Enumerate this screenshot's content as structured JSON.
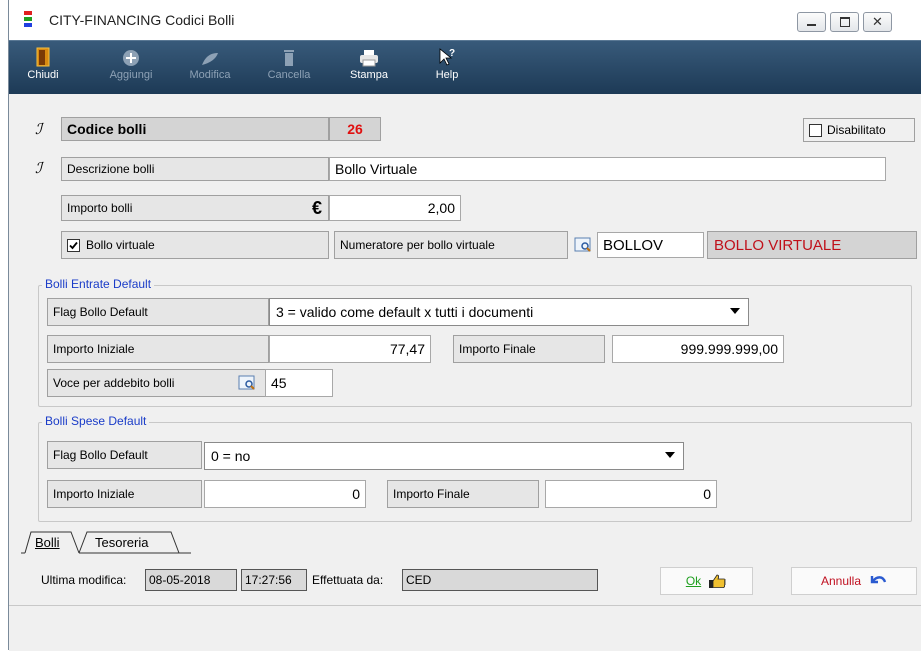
{
  "window": {
    "title": "CITY-FINANCING  Codici Bolli",
    "controls": {
      "minimize_icon": "minimize-icon",
      "maximize_icon": "maximize-icon",
      "close_icon": "close-icon"
    }
  },
  "toolbar": {
    "items": [
      {
        "label": "Chiudi",
        "icon": "exit-door-icon",
        "enabled": true
      },
      {
        "label": "Aggiungi",
        "icon": "add-icon",
        "enabled": false
      },
      {
        "label": "Modifica",
        "icon": "edit-icon",
        "enabled": false
      },
      {
        "label": "Cancella",
        "icon": "trash-icon",
        "enabled": false
      },
      {
        "label": "Stampa",
        "icon": "printer-icon",
        "enabled": true
      },
      {
        "label": "Help",
        "icon": "help-cursor-icon",
        "enabled": true
      }
    ]
  },
  "form": {
    "codice_label": "Codice bolli",
    "codice_value": "26",
    "disabilitato_label": "Disabilitato",
    "disabilitato_checked": false,
    "descrizione_label": "Descrizione bolli",
    "descrizione_value": "Bollo Virtuale",
    "importo_label": "Importo bolli",
    "currency_symbol": "€",
    "importo_value": "2,00",
    "bollo_virtuale_label": "Bollo virtuale",
    "bollo_virtuale_checked": true,
    "numeratore_label": "Numeratore per bollo virtuale",
    "numeratore_code": "BOLLOV",
    "numeratore_desc": "BOLLO VIRTUALE"
  },
  "entrate": {
    "title": "Bolli Entrate Default",
    "flag_label": "Flag Bollo Default",
    "flag_value": "3 = valido come default x tutti i documenti",
    "importo_iniziale_label": "Importo Iniziale",
    "importo_iniziale_value": "77,47",
    "importo_finale_label": "Importo Finale",
    "importo_finale_value": "999.999.999,00",
    "voce_label": "Voce per addebito bolli",
    "voce_value": "45"
  },
  "spese": {
    "title": "Bolli  Spese Default",
    "flag_label": "Flag Bollo Default",
    "flag_value": "0 = no",
    "importo_iniziale_label": "Importo Iniziale",
    "importo_iniziale_value": "0",
    "importo_finale_label": "Importo Finale",
    "importo_finale_value": "0"
  },
  "tabs": [
    {
      "label": "Bolli",
      "active": true
    },
    {
      "label": "Tesoreria",
      "active": false
    }
  ],
  "status": {
    "ultima_label": "Ultima modifica:",
    "date": "08-05-2018",
    "time": "17:27:56",
    "effettuata_label": "Effettuata da:",
    "user": "CED"
  },
  "buttons": {
    "ok": "Ok",
    "annulla": "Annulla"
  },
  "colors": {
    "toolbar_bg": "#1d3a56",
    "code_red": "#e01010",
    "desc_red": "#c0101a",
    "group_title_blue": "#1a3cc8"
  }
}
